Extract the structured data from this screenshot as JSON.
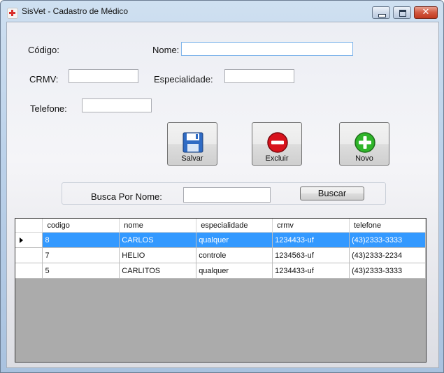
{
  "window": {
    "title": "SisVet - Cadastro de Médico",
    "icon": "app-cross-icon"
  },
  "form": {
    "codigo_label": "Código:",
    "codigo_value": "",
    "nome_label": "Nome:",
    "nome_value": "",
    "crmv_label": "CRMV:",
    "crmv_value": "",
    "especialidade_label": "Especialidade:",
    "especialidade_value": "",
    "telefone_label": "Telefone:",
    "telefone_value": ""
  },
  "actions": {
    "salvar": {
      "label": "Salvar",
      "icon": "floppy-disk-icon",
      "color": "#2f6bc4"
    },
    "excluir": {
      "label": "Excluir",
      "icon": "minus-circle-icon",
      "color": "#d8121c"
    },
    "novo": {
      "label": "Novo",
      "icon": "plus-circle-icon",
      "color": "#2fb52a"
    }
  },
  "search": {
    "label": "Busca Por Nome:",
    "value": "",
    "button": "Buscar"
  },
  "grid": {
    "columns": [
      "codigo",
      "nome",
      "especialidade",
      "crmv",
      "telefone"
    ],
    "rows": [
      {
        "codigo": "8",
        "nome": "CARLOS",
        "especialidade": "qualquer",
        "crmv": "1234433-uf",
        "telefone": "(43)2333-3333",
        "selected": true
      },
      {
        "codigo": "7",
        "nome": "HELIO",
        "especialidade": "controle",
        "crmv": "1234563-uf",
        "telefone": "(43)2333-2234",
        "selected": false
      },
      {
        "codigo": "5",
        "nome": "CARLITOS",
        "especialidade": "qualquer",
        "crmv": "1234433-uf",
        "telefone": "(43)2333-3333",
        "selected": false
      }
    ],
    "selection_color": "#3399ff"
  }
}
